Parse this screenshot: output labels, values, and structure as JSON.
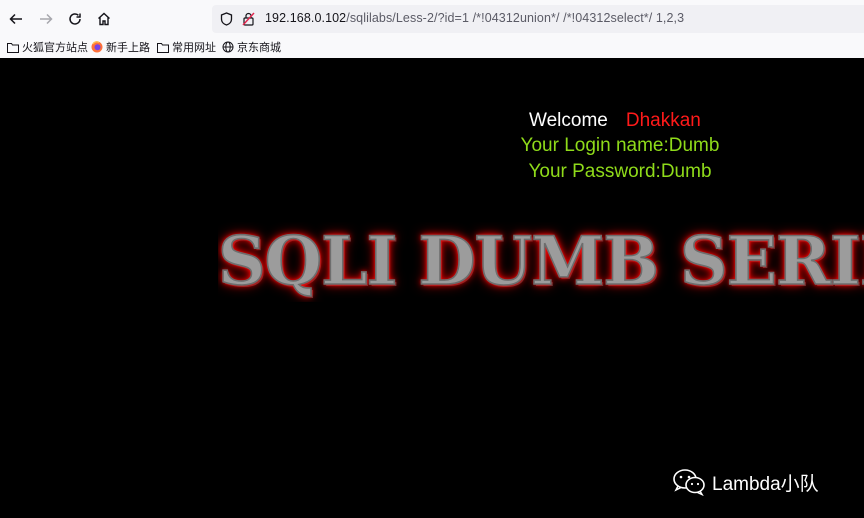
{
  "browser": {
    "url_host": "192.168.0.102",
    "url_path": "/sqlilabs/Less-2/?id=1 /*!04312union*/ /*!04312select*/ 1,2,3",
    "icons": [
      "back-icon",
      "forward-icon",
      "reload-icon",
      "home-icon",
      "shield-icon",
      "insecure-lock-icon"
    ]
  },
  "bookmarks": [
    {
      "label": "火狐官方站点",
      "icon": "folder-icon"
    },
    {
      "label": "新手上路",
      "icon": "firefox-icon"
    },
    {
      "label": "常用网址",
      "icon": "folder-icon"
    },
    {
      "label": "京东商城",
      "icon": "globe-icon"
    }
  ],
  "page": {
    "welcome_label": "Welcome",
    "welcome_user": "Dhakkan",
    "login_name": "Your Login name:Dumb",
    "password": "Your Password:Dumb",
    "banner": "SQLI DUMB SERIES"
  },
  "watermark": {
    "text": "Lambda小队",
    "icon": "wechat-icon"
  },
  "colors": {
    "background": "#000000",
    "welcome": "#ffffff",
    "user": "#ff1a1a",
    "green_text": "#8fdb1a"
  }
}
